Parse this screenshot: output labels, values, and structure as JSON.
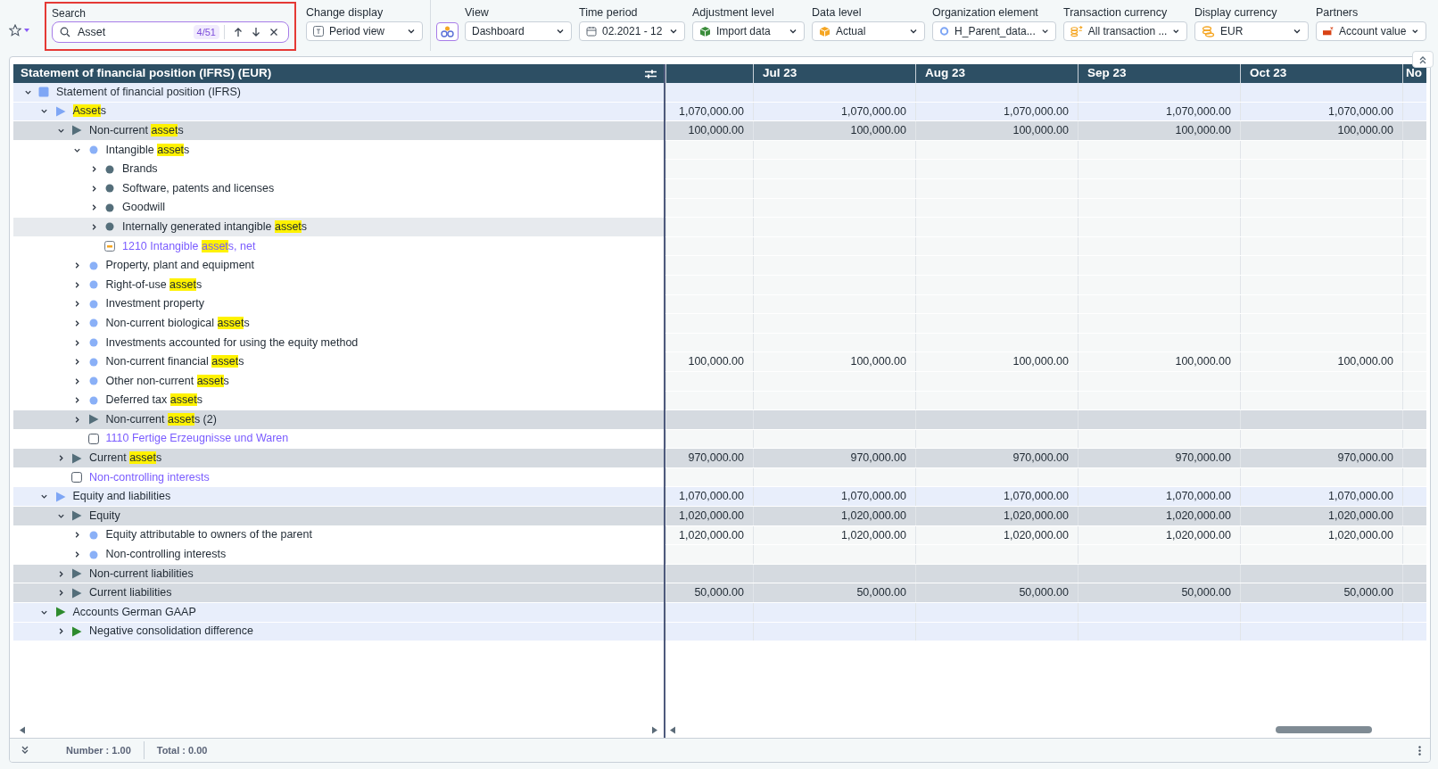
{
  "toolbar": {
    "search": {
      "label": "Search",
      "value": "Asset",
      "match_count": "4/51"
    },
    "display_switch": {
      "label": "Change display",
      "value": "Period view"
    },
    "filters": [
      {
        "label": "View",
        "value": "Dashboard"
      },
      {
        "label": "Time period",
        "value": "02.2021 - 12"
      },
      {
        "label": "Adjustment level",
        "value": "Import data"
      },
      {
        "label": "Data level",
        "value": "Actual"
      },
      {
        "label": "Organization element",
        "value": "H_Parent_data..."
      },
      {
        "label": "Transaction currency",
        "value": "All transaction ..."
      },
      {
        "label": "Display currency",
        "value": "EUR"
      },
      {
        "label": "Partners",
        "value": "Account value"
      }
    ]
  },
  "table": {
    "title": "Statement of financial position (IFRS) (EUR)",
    "columns": [
      "Jul 23",
      "Aug 23",
      "Sep 23",
      "Oct 23",
      "No"
    ],
    "rows": [
      {
        "kind": "section",
        "label": [
          {
            "text": "Statement of financial position (IFRS)",
            "match": false
          }
        ],
        "expanded": true,
        "hovered": false,
        "icon": {
          "kind": "square",
          "color": "#7ea6f5"
        },
        "children": [
          {
            "kind": "section",
            "label": [
              {
                "text": "Asset",
                "match": true
              },
              {
                "text": "s",
                "match": false
              }
            ],
            "expanded": true,
            "hovered": false,
            "icon": {
              "kind": "triangle",
              "color": "#7ea6f5"
            },
            "values": [
              "1,070,000.00",
              "1,070,000.00",
              "1,070,000.00",
              "1,070,000.00",
              "1,070,000.00"
            ],
            "children": [
              {
                "kind": "group",
                "label": [
                  {
                    "text": "Non-current ",
                    "match": false
                  },
                  {
                    "text": "asset",
                    "match": true
                  },
                  {
                    "text": "s",
                    "match": false
                  }
                ],
                "expanded": true,
                "hovered": false,
                "icon": {
                  "kind": "triangle",
                  "color": "#546e7a"
                },
                "values": [
                  "100,000.00",
                  "100,000.00",
                  "100,000.00",
                  "100,000.00",
                  "100,000.00"
                ],
                "children": [
                  {
                    "kind": "item",
                    "label": [
                      {
                        "text": "Intangible ",
                        "match": false
                      },
                      {
                        "text": "asset",
                        "match": true
                      },
                      {
                        "text": "s",
                        "match": false
                      }
                    ],
                    "expanded": true,
                    "hovered": false,
                    "icon": {
                      "kind": "dot",
                      "color": "#8ab0f7"
                    },
                    "children": [
                      {
                        "kind": "item",
                        "label": [
                          {
                            "text": "Brands",
                            "match": false
                          }
                        ],
                        "expanded": false,
                        "hovered": false,
                        "icon": {
                          "kind": "dot",
                          "color": "#546e7a"
                        }
                      },
                      {
                        "kind": "item",
                        "label": [
                          {
                            "text": "Software, patents and licenses",
                            "match": false
                          }
                        ],
                        "expanded": false,
                        "hovered": false,
                        "icon": {
                          "kind": "dot",
                          "color": "#546e7a"
                        }
                      },
                      {
                        "kind": "item",
                        "label": [
                          {
                            "text": "Goodwill",
                            "match": false
                          }
                        ],
                        "expanded": false,
                        "hovered": false,
                        "icon": {
                          "kind": "dot",
                          "color": "#546e7a"
                        }
                      },
                      {
                        "kind": "item",
                        "label": [
                          {
                            "text": "Internally generated intangible ",
                            "match": false
                          },
                          {
                            "text": "asset",
                            "match": true
                          },
                          {
                            "text": "s",
                            "match": false
                          }
                        ],
                        "expanded": false,
                        "hovered": true,
                        "icon": {
                          "kind": "dot",
                          "color": "#546e7a"
                        }
                      },
                      {
                        "kind": "account",
                        "label": [
                          {
                            "text": "1210 Intangible ",
                            "match": false
                          },
                          {
                            "text": "asset",
                            "match": true
                          },
                          {
                            "text": "s, net",
                            "match": false
                          }
                        ],
                        "hovered": false,
                        "icon": {
                          "kind": "card"
                        }
                      }
                    ]
                  },
                  {
                    "kind": "item",
                    "label": [
                      {
                        "text": "Property, plant and equipment",
                        "match": false
                      }
                    ],
                    "expanded": false,
                    "hovered": false,
                    "icon": {
                      "kind": "dot",
                      "color": "#8ab0f7"
                    }
                  },
                  {
                    "kind": "item",
                    "label": [
                      {
                        "text": "Right-of-use ",
                        "match": false
                      },
                      {
                        "text": "asset",
                        "match": true
                      },
                      {
                        "text": "s",
                        "match": false
                      }
                    ],
                    "expanded": false,
                    "hovered": false,
                    "icon": {
                      "kind": "dot",
                      "color": "#8ab0f7"
                    }
                  },
                  {
                    "kind": "item",
                    "label": [
                      {
                        "text": "Investment property",
                        "match": false
                      }
                    ],
                    "expanded": false,
                    "hovered": false,
                    "icon": {
                      "kind": "dot",
                      "color": "#8ab0f7"
                    }
                  },
                  {
                    "kind": "item",
                    "label": [
                      {
                        "text": "Non-current biological ",
                        "match": false
                      },
                      {
                        "text": "asset",
                        "match": true
                      },
                      {
                        "text": "s",
                        "match": false
                      }
                    ],
                    "expanded": false,
                    "hovered": false,
                    "icon": {
                      "kind": "dot",
                      "color": "#8ab0f7"
                    }
                  },
                  {
                    "kind": "item",
                    "label": [
                      {
                        "text": "Investments accounted for using the equity method",
                        "match": false
                      }
                    ],
                    "expanded": false,
                    "hovered": false,
                    "icon": {
                      "kind": "dot",
                      "color": "#8ab0f7"
                    }
                  },
                  {
                    "kind": "item",
                    "label": [
                      {
                        "text": "Non-current financial ",
                        "match": false
                      },
                      {
                        "text": "asset",
                        "match": true
                      },
                      {
                        "text": "s",
                        "match": false
                      }
                    ],
                    "expanded": false,
                    "hovered": false,
                    "icon": {
                      "kind": "dot",
                      "color": "#8ab0f7"
                    },
                    "values": [
                      "100,000.00",
                      "100,000.00",
                      "100,000.00",
                      "100,000.00",
                      "100,000.00"
                    ]
                  },
                  {
                    "kind": "item",
                    "label": [
                      {
                        "text": "Other non-current ",
                        "match": false
                      },
                      {
                        "text": "asset",
                        "match": true
                      },
                      {
                        "text": "s",
                        "match": false
                      }
                    ],
                    "expanded": false,
                    "hovered": false,
                    "icon": {
                      "kind": "dot",
                      "color": "#8ab0f7"
                    }
                  },
                  {
                    "kind": "item",
                    "label": [
                      {
                        "text": "Deferred tax ",
                        "match": false
                      },
                      {
                        "text": "asset",
                        "match": true
                      },
                      {
                        "text": "s",
                        "match": false
                      }
                    ],
                    "expanded": false,
                    "hovered": false,
                    "icon": {
                      "kind": "dot",
                      "color": "#8ab0f7"
                    }
                  },
                  {
                    "kind": "group",
                    "label": [
                      {
                        "text": "Non-current ",
                        "match": false
                      },
                      {
                        "text": "asset",
                        "match": true
                      },
                      {
                        "text": "s (2)",
                        "match": false
                      }
                    ],
                    "expanded": false,
                    "hovered": false,
                    "icon": {
                      "kind": "triangle",
                      "color": "#546e7a"
                    }
                  },
                  {
                    "kind": "account",
                    "label": [
                      {
                        "text": "1110 Fertige Erzeugnisse und Waren",
                        "match": false
                      }
                    ],
                    "hovered": false,
                    "icon": {
                      "kind": "blank"
                    }
                  }
                ]
              },
              {
                "kind": "group",
                "label": [
                  {
                    "text": "Current ",
                    "match": false
                  },
                  {
                    "text": "asset",
                    "match": true
                  },
                  {
                    "text": "s",
                    "match": false
                  }
                ],
                "expanded": false,
                "hovered": false,
                "icon": {
                  "kind": "triangle",
                  "color": "#546e7a"
                },
                "values": [
                  "970,000.00",
                  "970,000.00",
                  "970,000.00",
                  "970,000.00",
                  "970,000.00"
                ]
              },
              {
                "kind": "account",
                "label": [
                  {
                    "text": "Non-controlling interests",
                    "match": false
                  }
                ],
                "hovered": false,
                "icon": {
                  "kind": "blank"
                }
              }
            ]
          },
          {
            "kind": "section",
            "label": [
              {
                "text": "Equity and liabilities",
                "match": false
              }
            ],
            "expanded": true,
            "hovered": false,
            "icon": {
              "kind": "triangle",
              "color": "#7ea6f5"
            },
            "values": [
              "1,070,000.00",
              "1,070,000.00",
              "1,070,000.00",
              "1,070,000.00",
              "1,070,000.00"
            ],
            "children": [
              {
                "kind": "group",
                "label": [
                  {
                    "text": "Equity",
                    "match": false
                  }
                ],
                "expanded": true,
                "hovered": false,
                "icon": {
                  "kind": "triangle",
                  "color": "#546e7a"
                },
                "values": [
                  "1,020,000.00",
                  "1,020,000.00",
                  "1,020,000.00",
                  "1,020,000.00",
                  "1,020,000.00"
                ],
                "children": [
                  {
                    "kind": "item",
                    "label": [
                      {
                        "text": "Equity attributable to owners of the parent",
                        "match": false
                      }
                    ],
                    "expanded": false,
                    "hovered": false,
                    "icon": {
                      "kind": "dot",
                      "color": "#8ab0f7"
                    },
                    "values": [
                      "1,020,000.00",
                      "1,020,000.00",
                      "1,020,000.00",
                      "1,020,000.00",
                      "1,020,000.00"
                    ]
                  },
                  {
                    "kind": "item",
                    "label": [
                      {
                        "text": "Non-controlling interests",
                        "match": false
                      }
                    ],
                    "expanded": false,
                    "hovered": false,
                    "icon": {
                      "kind": "dot",
                      "color": "#8ab0f7"
                    }
                  }
                ]
              },
              {
                "kind": "group",
                "label": [
                  {
                    "text": "Non-current liabilities",
                    "match": false
                  }
                ],
                "expanded": false,
                "hovered": false,
                "icon": {
                  "kind": "triangle",
                  "color": "#546e7a"
                }
              },
              {
                "kind": "group",
                "label": [
                  {
                    "text": "Current liabilities",
                    "match": false
                  }
                ],
                "expanded": false,
                "hovered": false,
                "icon": {
                  "kind": "triangle",
                  "color": "#546e7a"
                },
                "values": [
                  "50,000.00",
                  "50,000.00",
                  "50,000.00",
                  "50,000.00",
                  "50,000.00"
                ]
              }
            ]
          },
          {
            "kind": "section",
            "label": [
              {
                "text": "Accounts German GAAP",
                "match": false
              }
            ],
            "expanded": true,
            "hovered": false,
            "icon": {
              "kind": "triangle",
              "color": "#2e8b2e"
            },
            "children": [
              {
                "kind": "section",
                "label": [
                  {
                    "text": "Negative consolidation difference",
                    "match": false
                  }
                ],
                "expanded": false,
                "hovered": false,
                "icon": {
                  "kind": "triangle",
                  "color": "#2e8b2e"
                }
              }
            ]
          }
        ]
      }
    ]
  },
  "footer": {
    "number": "Number : 1.00",
    "total": "Total : 0.00"
  }
}
